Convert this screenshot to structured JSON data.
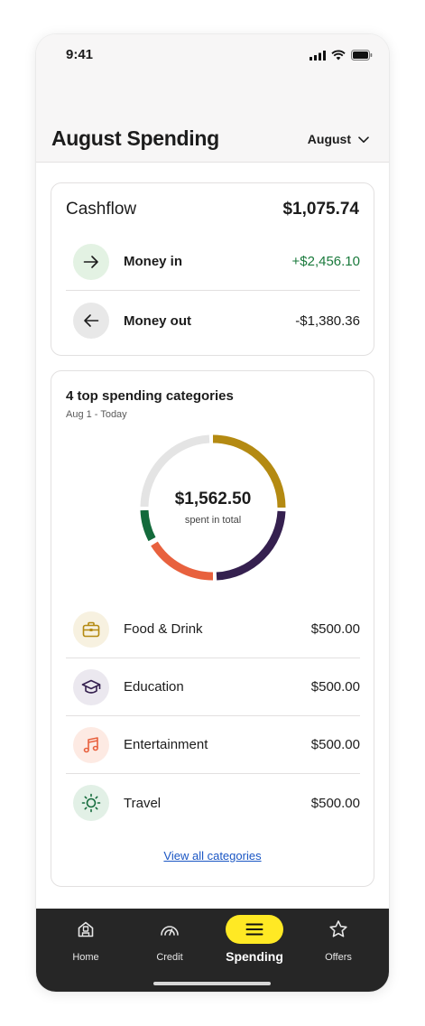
{
  "status_bar": {
    "time": "9:41"
  },
  "header": {
    "title": "August Spending",
    "month_selector": "August"
  },
  "cashflow": {
    "title": "Cashflow",
    "total": "$1,075.74",
    "rows": [
      {
        "label": "Money in",
        "amount": "+$2,456.10",
        "icon": "arrow-right-icon"
      },
      {
        "label": "Money out",
        "amount": "-$1,380.36",
        "icon": "arrow-left-icon"
      }
    ]
  },
  "spending": {
    "title": "4 top spending categories",
    "date_range": "Aug 1 - Today",
    "total_amount": "$1,562.50",
    "total_label": "spent in total",
    "view_all": "View all categories",
    "categories": [
      {
        "label": "Food & Drink",
        "amount": "$500.00",
        "icon": "briefcase-icon",
        "color": "#b48a12"
      },
      {
        "label": "Education",
        "amount": "$500.00",
        "icon": "graduation-cap-icon",
        "color": "#35204f"
      },
      {
        "label": "Entertainment",
        "amount": "$500.00",
        "icon": "music-note-icon",
        "color": "#e8613e"
      },
      {
        "label": "Travel",
        "amount": "$500.00",
        "icon": "sun-icon",
        "color": "#136a3b"
      }
    ]
  },
  "colors": {
    "money_in": "#1a7a3c",
    "accent_yellow": "#ffe924",
    "link": "#1a56c4",
    "remainder": "#e4e4e4"
  },
  "tabs": [
    {
      "label": "Home",
      "icon": "home-icon"
    },
    {
      "label": "Credit",
      "icon": "credit-gauge-icon"
    },
    {
      "label": "Spending",
      "icon": "menu-icon",
      "active": true
    },
    {
      "label": "Offers",
      "icon": "star-icon"
    }
  ]
}
